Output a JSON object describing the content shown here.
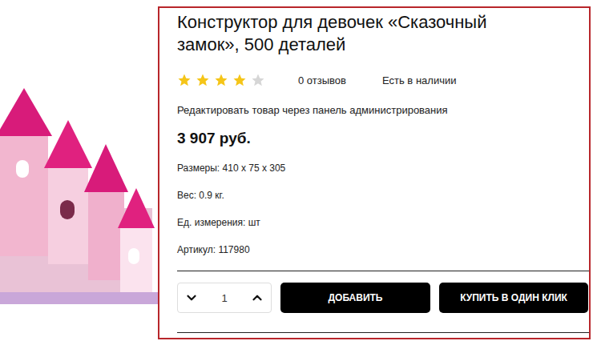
{
  "product": {
    "title": "Конструктор для девочек «Сказочный замок», 500 деталей",
    "stars": 4,
    "reviews": "0 отзывов",
    "availability": "Есть в наличии",
    "admin_note": "Редактировать товар через панель администрирования",
    "price": "3 907 руб.",
    "specs": [
      "Размеры: 410 x 75 x 305",
      "Вес: 0.9 кг.",
      "Ед. измерения: шт",
      "Артикул: 117980"
    ]
  },
  "quantity": "1",
  "buttons": [
    "ДОБАВИТЬ",
    "КУПИТЬ В ОДИН КЛИК"
  ]
}
